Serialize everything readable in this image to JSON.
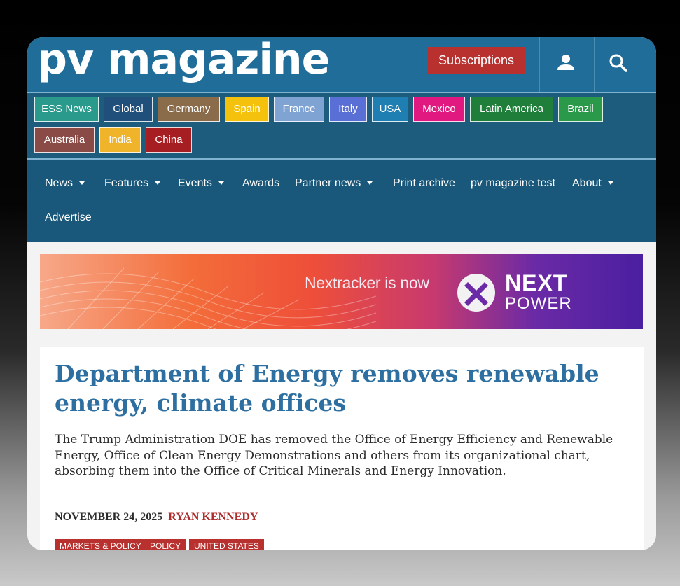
{
  "header": {
    "logo": "pv magazine",
    "subscriptions_label": "Subscriptions",
    "user_icon": "user-icon",
    "search_icon": "search-icon"
  },
  "regions": [
    {
      "label": "ESS News",
      "color": "#2a9a8c"
    },
    {
      "label": "Global",
      "color": "#1f4f7a"
    },
    {
      "label": "Germany",
      "color": "#8a6b4a"
    },
    {
      "label": "Spain",
      "color": "#f4c20d"
    },
    {
      "label": "France",
      "color": "#7fa4d4"
    },
    {
      "label": "Italy",
      "color": "#5a6fd6"
    },
    {
      "label": "USA",
      "color": "#1f7fb2"
    },
    {
      "label": "Mexico",
      "color": "#e0187f"
    },
    {
      "label": "Latin America",
      "color": "#1f7f3a"
    },
    {
      "label": "Brazil",
      "color": "#2a9a4a"
    },
    {
      "label": "Australia",
      "color": "#8a4a45"
    },
    {
      "label": "India",
      "color": "#f0b42a"
    },
    {
      "label": "China",
      "color": "#a61e22"
    }
  ],
  "nav": [
    {
      "label": "News",
      "dropdown": true
    },
    {
      "label": "Features",
      "dropdown": true
    },
    {
      "label": "Events",
      "dropdown": true
    },
    {
      "label": "Awards",
      "dropdown": false
    },
    {
      "label": "Partner news",
      "dropdown": true
    },
    {
      "label": "Print archive",
      "dropdown": false
    },
    {
      "label": "pv magazine test",
      "dropdown": false
    },
    {
      "label": "About",
      "dropdown": true
    },
    {
      "label": "Advertise",
      "dropdown": false
    }
  ],
  "banner": {
    "text": "Nextracker is now",
    "brand_line1": "NEXT",
    "brand_line2": "POWER"
  },
  "article": {
    "title": "Department of Energy removes renewable energy, climate offices",
    "lead": "The Trump Administration DOE has removed the Office of Energy Efficiency and Renewable Energy, Office of Clean Energy Demonstrations and others from its organizational chart, absorbing them into the Office of Critical Minerals and Energy Innovation.",
    "date": "NOVEMBER 24, 2025",
    "author": "RYAN KENNEDY",
    "tags": [
      "MARKETS & POLICY",
      "POLICY",
      "UNITED STATES"
    ]
  },
  "colors": {
    "header_blue": "#1f6d98",
    "region_bar": "#1e5c7e",
    "nav_bar": "#19587a",
    "accent_red": "#b8312f",
    "title_blue": "#2c6fa0"
  }
}
